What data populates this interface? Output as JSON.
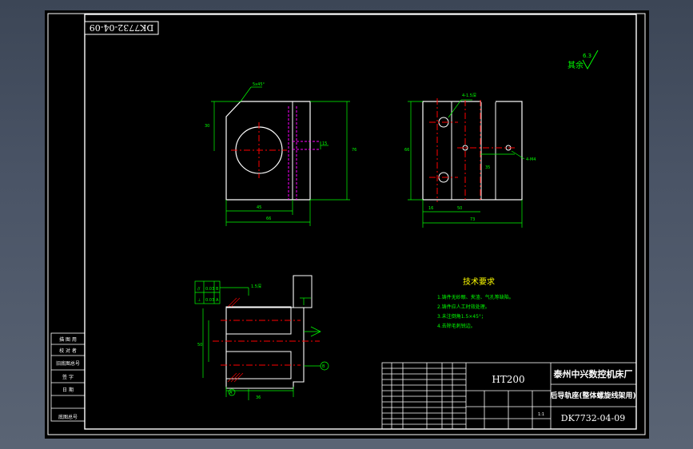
{
  "drawing": {
    "code_flipped": "DK7732-04-09",
    "roughness_label": "其余",
    "roughness_value": "6.3",
    "tech_req": {
      "title": "技术要求",
      "items": [
        "1.铸件无砂眼、夹渣、气孔等缺陷。",
        "2.铸件应人工时效处理。",
        "3.未注倒角1.5×45°；",
        "4.去除毛刺锐边。"
      ]
    },
    "title_block": {
      "material": "HT200",
      "company": "泰州中兴数控机床厂",
      "part_name": "后导轨座(整体螺旋线架用)",
      "drawing_number": "DK7732-04-09",
      "scale": "1:1"
    },
    "side_table": [
      "描 图 用",
      "校 对 者",
      "旧底图总号",
      "签 字",
      "日 期",
      "底图总号"
    ],
    "datum_labels": [
      "A",
      "B"
    ],
    "tolerance_values": [
      "0.03",
      "0.03"
    ]
  },
  "colors": {
    "background": "#000000",
    "frame": "#ffffff",
    "dimension": "#00ff00",
    "center_line": "#ff0000",
    "hidden_line": "#ff00ff",
    "text": "#ffffff",
    "tech_title": "#ffff00"
  }
}
